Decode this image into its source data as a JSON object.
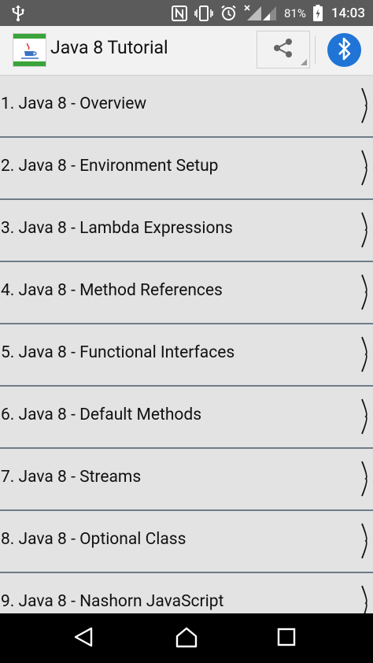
{
  "status_bar": {
    "battery_percent": "81%",
    "time": "14:03"
  },
  "app_bar": {
    "title": "Java 8 Tutorial"
  },
  "list": {
    "items": [
      {
        "label": "1. Java 8 - Overview"
      },
      {
        "label": "2. Java 8 - Environment Setup"
      },
      {
        "label": "3. Java 8 - Lambda Expressions"
      },
      {
        "label": "4. Java 8 - Method References"
      },
      {
        "label": "5. Java 8 - Functional Interfaces"
      },
      {
        "label": "6. Java 8 - Default Methods"
      },
      {
        "label": "7. Java 8 - Streams"
      },
      {
        "label": "8. Java 8 - Optional Class"
      },
      {
        "label": "9. Java 8 - Nashorn JavaScript"
      }
    ]
  },
  "icons": {
    "usb": "usb-icon",
    "nfc": "nfc-icon",
    "vibrate": "vibrate-icon",
    "alarm": "alarm-icon",
    "signal": "signal-icon",
    "battery": "battery-icon",
    "share": "share-icon",
    "bluetooth": "bluetooth-icon",
    "chevron": "chevron-right-icon",
    "back": "back-icon",
    "home": "home-icon",
    "recents": "recents-icon"
  },
  "colors": {
    "status_bar_bg": "#5b5b5b",
    "app_bar_bg": "#f2f2f2",
    "list_row_bg": "#e3e3e3",
    "row_divider": "#6f7c88",
    "bluetooth_bg": "#1f74d6",
    "nav_bar_bg": "#000000"
  }
}
